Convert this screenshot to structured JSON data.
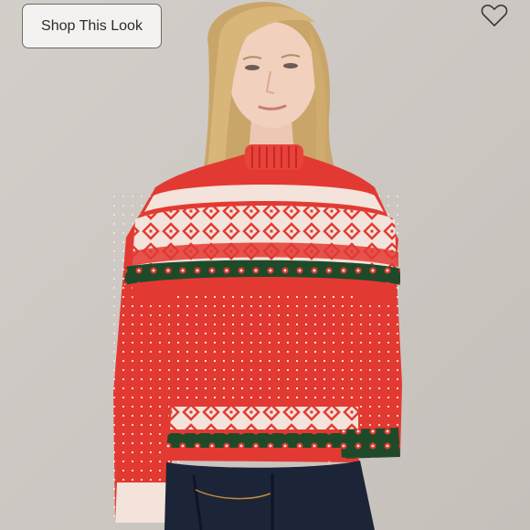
{
  "shop_button": {
    "label": "Shop This Look"
  },
  "icons": {
    "like": "heart-icon"
  },
  "colors": {
    "background": "#cdc7c2",
    "sweater_red": "#e23a32",
    "sweater_cream": "#f3e3da",
    "sweater_green": "#1f4a2a",
    "jeans": "#1c2438"
  }
}
